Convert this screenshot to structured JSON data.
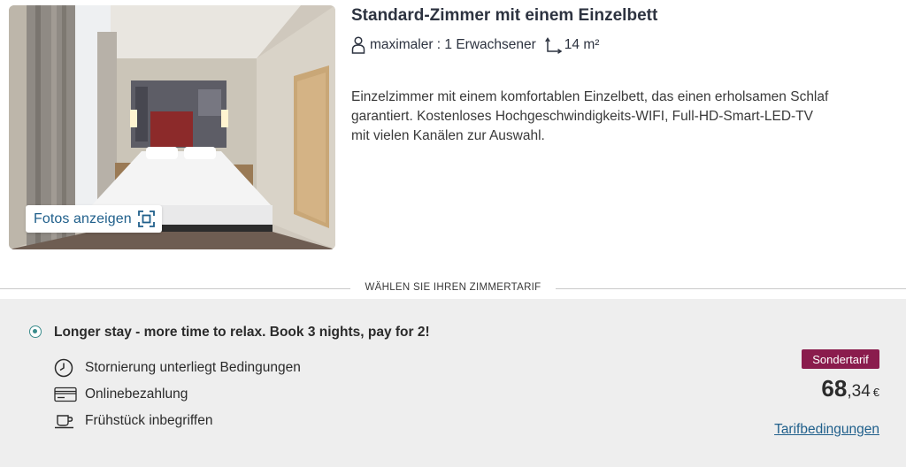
{
  "room": {
    "title": "Standard-Zimmer mit einem Einzelbett",
    "occupancy": "maximaler : 1 Erwachsener",
    "area": "14 m²",
    "description": "Einzelzimmer mit einem komfortablen Einzelbett, das einen erholsamen Schlaf garantiert. Kostenloses Hochgeschwindigkeits-WIFI, Full-HD-Smart-LED-TV mit vielen Kanälen zur Auswahl.",
    "photos_button": "Fotos anzeigen"
  },
  "divider": {
    "label": "WÄHLEN SIE IHREN ZIMMERTARIF"
  },
  "rate": {
    "title": "Longer stay - more time to relax. Book 3 nights, pay for 2!",
    "selected": true,
    "features": [
      {
        "icon": "clock-icon",
        "label": "Stornierung unterliegt Bedingungen"
      },
      {
        "icon": "credit-card-icon",
        "label": "Onlinebezahlung"
      },
      {
        "icon": "coffee-cup-icon",
        "label": "Frühstück inbegriffen"
      }
    ],
    "badge": "Sondertarif",
    "price_whole": "68",
    "price_cents": ",34",
    "currency": "€",
    "conditions_link": "Tarifbedingungen"
  },
  "colors": {
    "accent_link": "#1f5f8b",
    "badge_bg": "#8a1c4d",
    "radio": "#3a8c8c",
    "panel_bg": "#eeeeee"
  }
}
